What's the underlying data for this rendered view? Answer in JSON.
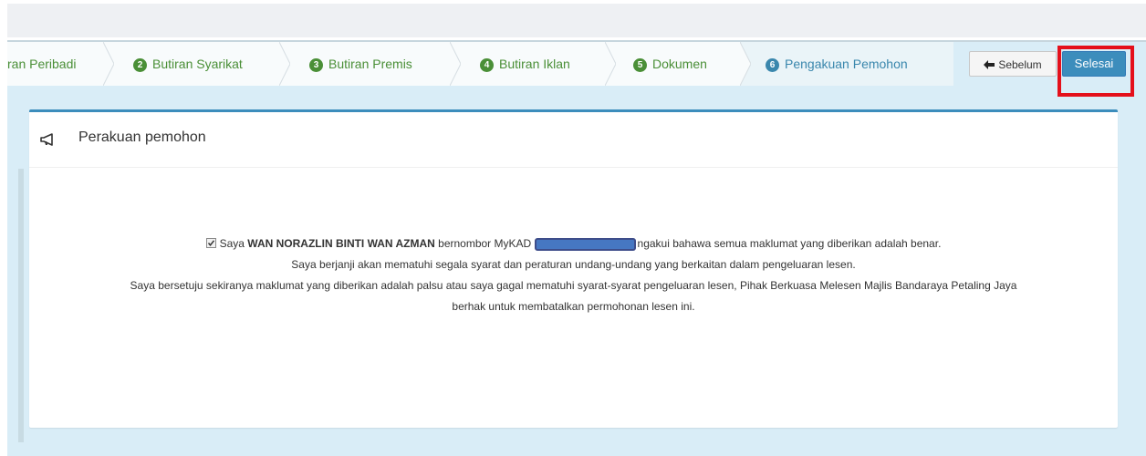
{
  "wizard": {
    "steps": [
      {
        "num": "",
        "label": "ran Peribadi"
      },
      {
        "num": "2",
        "label": "Butiran Syarikat"
      },
      {
        "num": "3",
        "label": "Butiran Premis"
      },
      {
        "num": "4",
        "label": "Butiran Iklan"
      },
      {
        "num": "5",
        "label": "Dokumen"
      },
      {
        "num": "6",
        "label": "Pengakuan Pemohon"
      }
    ],
    "prev_label": "Sebelum",
    "done_label": "Selesai"
  },
  "panel": {
    "title": "Perakuan pemohon",
    "l1_a": "Saya ",
    "name": "WAN NORAZLIN BINTI WAN AZMAN",
    "l1_b": " bernombor MyKAD ",
    "l1_c": "ngakui bahawa semua maklumat yang diberikan adalah benar.",
    "l2": "Saya berjanji akan mematuhi segala syarat dan peraturan undang-undang yang berkaitan dalam pengeluaran lesen.",
    "l3": "Saya bersetuju sekiranya maklumat yang diberikan adalah palsu atau saya gagal mematuhi syarat-syarat pengeluaran lesen, Pihak Berkuasa Melesen Majlis Bandaraya Petaling Jaya",
    "l4": "berhak untuk membatalkan permohonan lesen ini."
  },
  "colors": {
    "accent": "#3c8dbc",
    "step_done": "#4a8f37",
    "highlight": "#e4101b"
  }
}
